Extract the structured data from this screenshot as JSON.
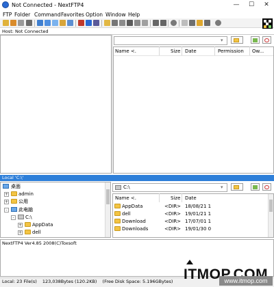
{
  "window": {
    "title": "Not Connected - NextFTP4",
    "controls": {
      "minimize": "—",
      "maximize": "☐",
      "close": "✕"
    }
  },
  "menu": [
    "FTP",
    "Folder",
    "Command",
    "Favorites",
    "Option",
    "Window",
    "Help"
  ],
  "host": {
    "label": "Host: Not Connected"
  },
  "remote": {
    "path_value": "",
    "columns": [
      "Name <.",
      "Size",
      "Date",
      "Permission",
      "Ow..."
    ]
  },
  "local": {
    "label": "Local 'C:\\'",
    "tree": [
      {
        "label": "桌面",
        "icon": "desktop-icon",
        "expand": ""
      },
      {
        "label": "admin",
        "icon": "folder-icon",
        "expand": "+"
      },
      {
        "label": "公用",
        "icon": "folder-icon",
        "expand": "+"
      },
      {
        "label": "此电脑",
        "icon": "computer-icon",
        "expand": "-"
      },
      {
        "label": "C:\\",
        "icon": "drive-icon",
        "expand": "-"
      },
      {
        "label": "AppData",
        "icon": "folder-icon",
        "expand": "+"
      },
      {
        "label": "dell",
        "icon": "folder-icon",
        "expand": "+"
      }
    ],
    "path_value": "C:\\",
    "columns": [
      "Name <.",
      "Size",
      "Date"
    ],
    "files": [
      {
        "name": "AppData",
        "size": "<DIR>",
        "date": "18/08/21 1"
      },
      {
        "name": "dell",
        "size": "<DIR>",
        "date": "19/01/21 1"
      },
      {
        "name": "Download",
        "size": "<DIR>",
        "date": "17/07/01 1"
      },
      {
        "name": "Downloads",
        "size": "<DIR>",
        "date": "19/01/30 0"
      }
    ]
  },
  "log": {
    "text": "NextFTP4 Ver4.85 2008(C)Toxsoft"
  },
  "status": {
    "files": "Local: 23 File(s)",
    "bytes": "123,038Bytes (120.2KB)",
    "disk": "(Free Disk Space: 5.196GBytes)"
  },
  "watermark": {
    "logo": "ITMOP.COM",
    "url": "www.itmop.com"
  }
}
